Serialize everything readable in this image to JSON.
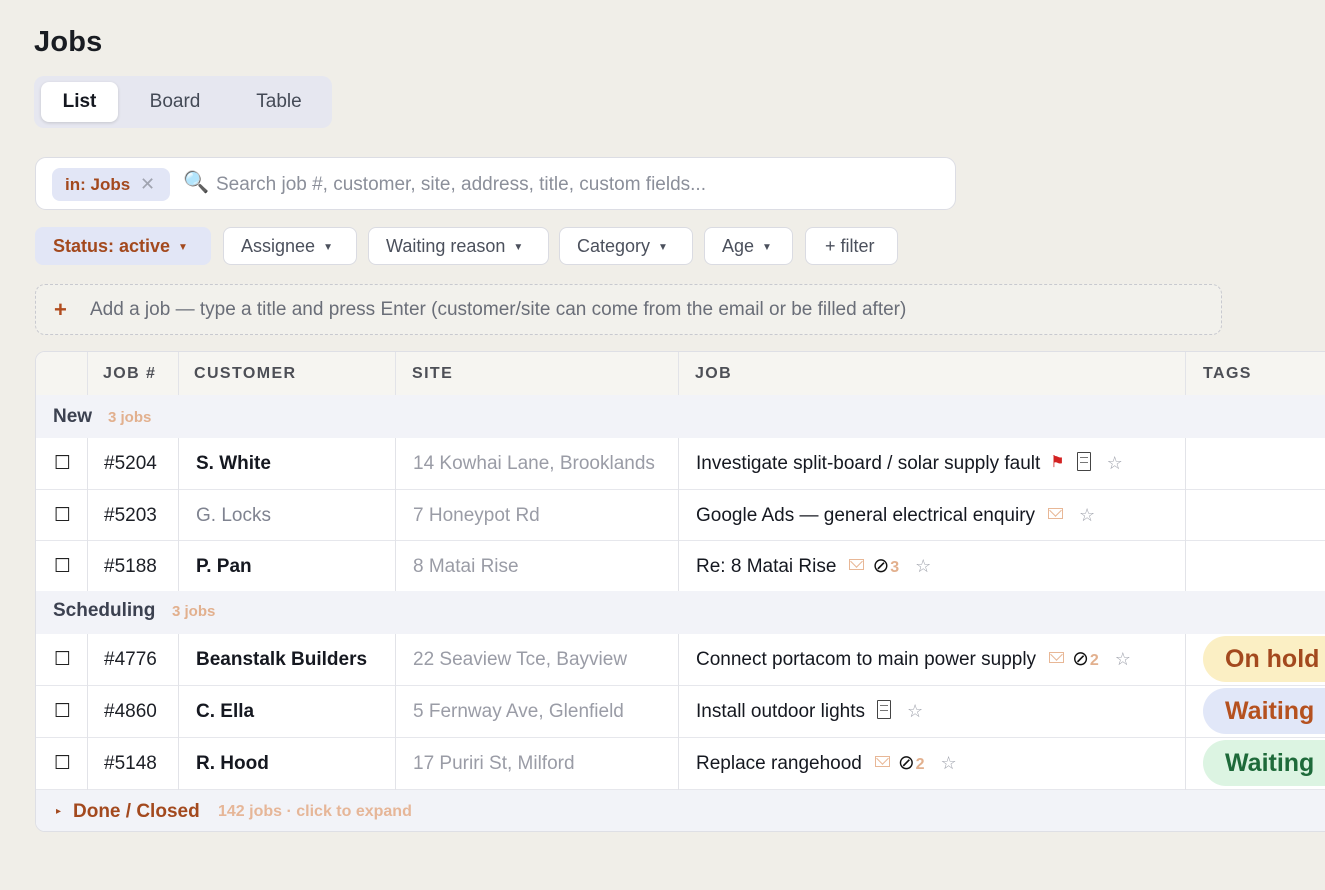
{
  "page": {
    "title": "Jobs"
  },
  "view_tabs": [
    {
      "label": "List",
      "active": true
    },
    {
      "label": "Board",
      "active": false
    },
    {
      "label": "Table",
      "active": false
    }
  ],
  "search": {
    "scope_chip": "in: Jobs",
    "placeholder": "Search job #, customer, site, address, title, custom fields...",
    "value": ""
  },
  "filters": {
    "status": "Status: active",
    "assignee": "Assignee",
    "waiting_reason": "Waiting reason",
    "category": "Category",
    "age": "Age",
    "add": "+ filter"
  },
  "add_job": {
    "plus": "+",
    "placeholder": "Add a job — type a title and press Enter (customer/site can come from the email or be filled after)"
  },
  "table": {
    "headers": {
      "job_no": "JOB #",
      "customer": "CUSTOMER",
      "site": "SITE",
      "job": "JOB",
      "tags": "TAGS"
    },
    "groups": [
      {
        "name": "New",
        "count": "3 jobs",
        "rows": [
          {
            "checkbox": "☐",
            "job_no": "#5204",
            "customer": "S. White",
            "customer_bold": true,
            "site": "14 Kowhai Lane, Brooklands",
            "job": "Investigate split-board / solar supply fault",
            "icons": [
              "flag",
              "doc"
            ],
            "clip_count": "",
            "tag": ""
          },
          {
            "checkbox": "☐",
            "job_no": "#5203",
            "customer": "G. Locks",
            "customer_bold": false,
            "site": "7 Honeypot Rd",
            "job": "Google Ads — general electrical enquiry",
            "icons": [
              "mail"
            ],
            "clip_count": "",
            "tag": ""
          },
          {
            "checkbox": "☐",
            "job_no": "#5188",
            "customer": "P. Pan",
            "customer_bold": true,
            "site": "8 Matai Rise",
            "job": "Re: 8 Matai Rise",
            "icons": [
              "mail",
              "clip"
            ],
            "clip_count": "3",
            "tag": ""
          }
        ]
      },
      {
        "name": "Scheduling",
        "count": "3 jobs",
        "rows": [
          {
            "checkbox": "☐",
            "job_no": "#4776",
            "customer": "Beanstalk Builders",
            "customer_bold": true,
            "site": "22 Seaview Tce, Bayview",
            "job": "Connect portacom to main power supply",
            "icons": [
              "mail",
              "clip"
            ],
            "clip_count": "2",
            "tag": "On hold"
          },
          {
            "checkbox": "☐",
            "job_no": "#4860",
            "customer": "C. Ella",
            "customer_bold": true,
            "site": "5 Fernway Ave, Glenfield",
            "job": "Install outdoor lights",
            "icons": [
              "doc"
            ],
            "clip_count": "",
            "tag": "Waiting"
          },
          {
            "checkbox": "☐",
            "job_no": "#5148",
            "customer": "R. Hood",
            "customer_bold": true,
            "site": "17 Puriri St, Milford",
            "job": "Replace rangehood",
            "icons": [
              "mail",
              "clip"
            ],
            "clip_count": "2",
            "tag": "Waiting"
          }
        ]
      }
    ],
    "done": {
      "caret": "▸",
      "label": "Done / Closed",
      "count": "142 jobs · click to expand"
    }
  },
  "colors": {
    "accent": "#a3491e",
    "tag_on_hold_bg": "#fbefc4",
    "tag_on_hold_fg": "#a3491e",
    "tag_waiting_blue_bg": "#e1e7f8",
    "tag_waiting_blue_fg": "#b5511f",
    "tag_waiting_green_bg": "#dcf4e2",
    "tag_waiting_green_fg": "#1e6a3a"
  },
  "icons": {
    "search": "magnifier-icon",
    "flag": "flag-icon",
    "doc": "document-icon",
    "mail": "mail-icon",
    "clip": "paperclip-icon",
    "star": "star-icon"
  }
}
